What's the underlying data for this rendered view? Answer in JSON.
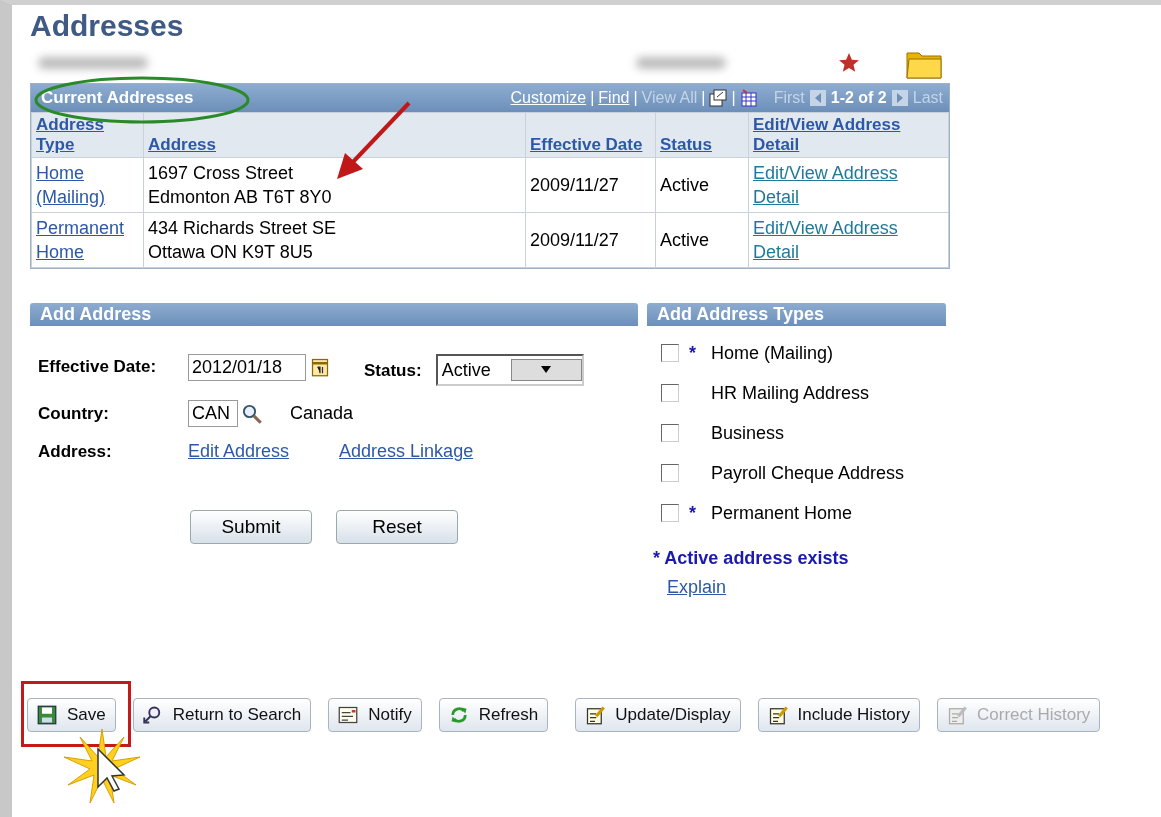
{
  "title": "Addresses",
  "grid": {
    "title": "Current Addresses",
    "separators": [
      "|",
      "|",
      "|",
      "|"
    ],
    "customize": "Customize",
    "find": "Find",
    "view_all": {
      "label": "View All",
      "disabled": true
    },
    "first": {
      "label": "First",
      "disabled": true
    },
    "range": "1-2 of 2",
    "last": {
      "label": "Last",
      "disabled": true
    },
    "columns": [
      "Address Type",
      "Address",
      "Effective Date",
      "Status",
      "Edit/View Address Detail"
    ],
    "rows": [
      {
        "type": "Home (Mailing)",
        "address": [
          "1697 Cross Street",
          "Edmonton AB T6T 8Y0"
        ],
        "date": "2009/11/27",
        "status": "Active",
        "detail": "Edit/View Address Detail"
      },
      {
        "type": "Permanent Home",
        "address": [
          "434 Richards Street SE",
          "Ottawa ON K9T 8U5"
        ],
        "date": "2009/11/27",
        "status": "Active",
        "detail": "Edit/View Address Detail"
      }
    ]
  },
  "add_address": {
    "title": "Add Address",
    "effective_date_label": "Effective Date:",
    "effective_date": "2012/01/18",
    "status_label": "Status:",
    "status": "Active",
    "country_label": "Country:",
    "country": "CAN",
    "country_name": "Canada",
    "address_label": "Address:",
    "edit_address": "Edit Address",
    "address_linkage": "Address Linkage",
    "submit": "Submit",
    "reset": "Reset"
  },
  "address_types": {
    "title": "Add Address Types",
    "items": [
      {
        "label": "Home (Mailing)",
        "checked": false,
        "marker": "*"
      },
      {
        "label": "HR Mailing Address",
        "checked": false
      },
      {
        "label": "Business",
        "checked": false
      },
      {
        "label": "Payroll Cheque Address",
        "checked": false
      },
      {
        "label": "Permanent Home",
        "checked": false,
        "marker": "*"
      }
    ],
    "note": "* Active address exists",
    "explain": "Explain"
  },
  "toolbar": [
    {
      "kind": "save",
      "label": "Save",
      "disabled": false
    },
    {
      "kind": "search",
      "label": "Return to Search",
      "disabled": false
    },
    {
      "kind": "notify",
      "label": "Notify",
      "disabled": false
    },
    {
      "kind": "refresh",
      "label": "Refresh",
      "disabled": false
    },
    {
      "kind": "update",
      "label": "Update/Display",
      "disabled": false
    },
    {
      "kind": "history",
      "label": "Include History",
      "disabled": false
    },
    {
      "kind": "correct",
      "label": "Correct History",
      "disabled": true
    }
  ]
}
